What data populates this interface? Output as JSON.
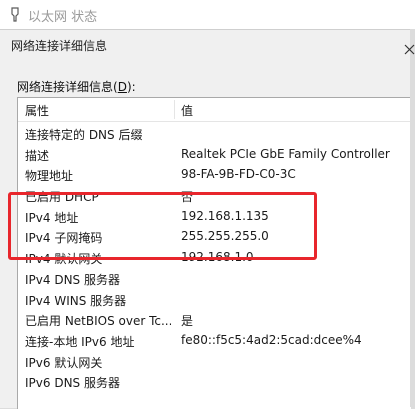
{
  "parent_window": {
    "title": "以太网 状态"
  },
  "dialog": {
    "title": "网络连接详细信息",
    "section_label_prefix": "网络连接详细信息(",
    "section_label_key": "D",
    "section_label_suffix": "):"
  },
  "list": {
    "columns": {
      "name": "属性",
      "value": "值"
    },
    "rows": [
      {
        "name": "连接特定的 DNS 后缀",
        "value": ""
      },
      {
        "name": "描述",
        "value": "Realtek PCIe GbE Family Controller"
      },
      {
        "name": "物理地址",
        "value": "98-FA-9B-FD-C0-3C"
      },
      {
        "name": "已启用 DHCP",
        "value": "否"
      },
      {
        "name": "IPv4 地址",
        "value": "192.168.1.135"
      },
      {
        "name": "IPv4 子网掩码",
        "value": "255.255.255.0"
      },
      {
        "name": "IPv4 默认网关",
        "value": "192.168.1.0"
      },
      {
        "name": "IPv4 DNS 服务器",
        "value": ""
      },
      {
        "name": "IPv4 WINS 服务器",
        "value": ""
      },
      {
        "name": "已启用 NetBIOS over Tc...",
        "value": "是"
      },
      {
        "name": "连接-本地 IPv6 地址",
        "value": "fe80::f5c5:4ad2:5cad:dcee%4"
      },
      {
        "name": "IPv6 默认网关",
        "value": ""
      },
      {
        "name": "IPv6 DNS 服务器",
        "value": ""
      }
    ]
  },
  "colors": {
    "highlight": "#e8262c",
    "list_bg": "#ffffff",
    "dialog_bg": "#f0f0f0"
  },
  "icons": {
    "parent_window": "network-adapter-icon",
    "close": "close-icon"
  }
}
